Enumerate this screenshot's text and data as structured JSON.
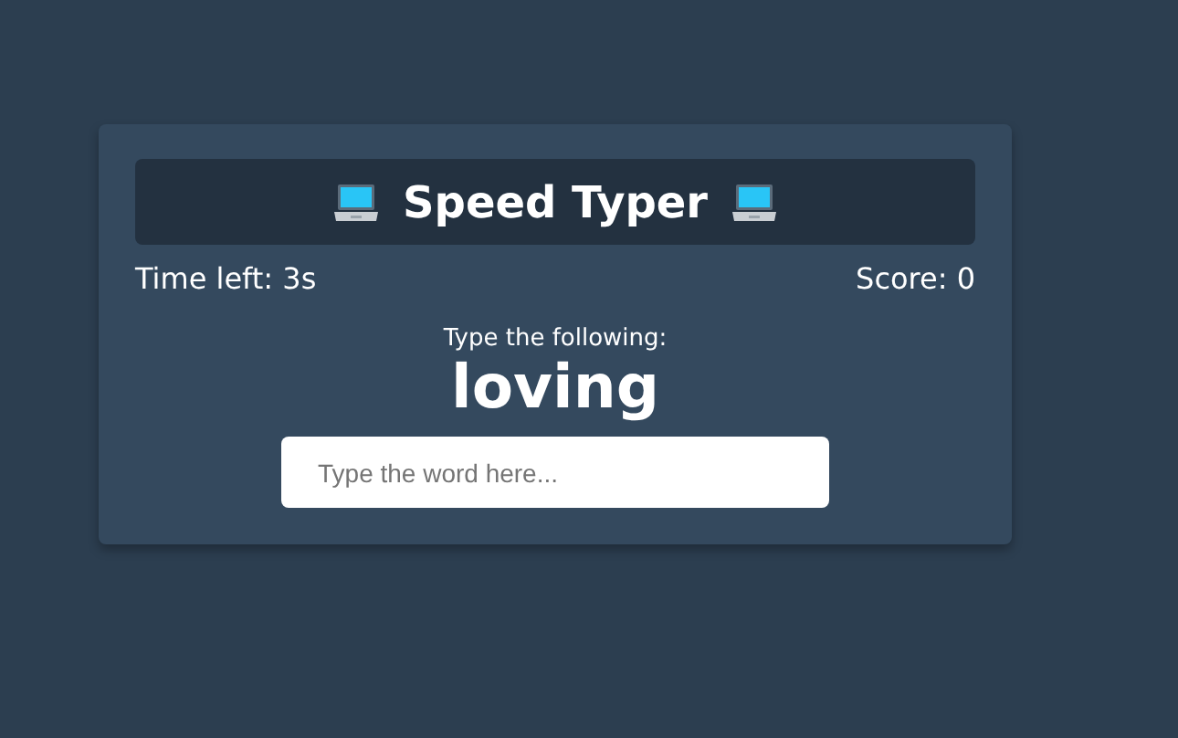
{
  "title": "Speed Typer",
  "stats": {
    "time_left": "Time left: 3s",
    "score": "Score: 0"
  },
  "prompt": {
    "label": "Type the following:",
    "word": "loving"
  },
  "input": {
    "placeholder": "Type the word here..."
  }
}
